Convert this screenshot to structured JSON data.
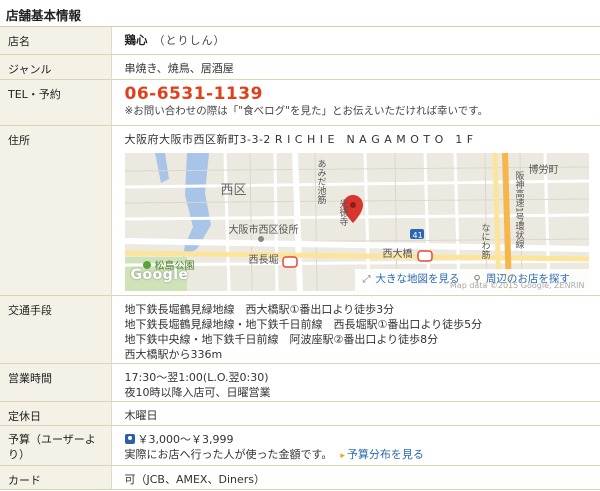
{
  "section": {
    "title": "店舗基本情報"
  },
  "rows": {
    "name": {
      "label": "店名",
      "value": "鶏心",
      "kana": "（とりしん）"
    },
    "genre": {
      "label": "ジャンル",
      "value": "串焼き、焼鳥、居酒屋"
    },
    "tel": {
      "label": "TEL・予約",
      "phone": "06-6531-1139",
      "note": "※お問い合わせの際は「\"食べログ\"を見た」とお伝えいただければ幸いです。"
    },
    "address": {
      "label": "住所",
      "value": "大阪府大阪市西区新町3-3-2 R I C H I E　N A G A M O T O　1 F",
      "map": {
        "labels": [
          "西区",
          "大阪市西区役所",
          "松島公園",
          "西長堀",
          "西大橋",
          "博労町",
          "あみだ池筋",
          "光徳寺",
          "なにわ筋",
          "阪神高速1号環状線",
          "41"
        ],
        "large_map_link": "大きな地図を見る",
        "nearby_link": "周辺のお店を探す",
        "google": "Google",
        "map_data": "Map data ©2015 Google, ZENRIN"
      }
    },
    "access": {
      "label": "交通手段",
      "lines": [
        "地下鉄長堀鶴見緑地線　西大橋駅①番出口より徒歩3分",
        "地下鉄長堀鶴見緑地線・地下鉄千日前線　西長堀駅①番出口より徒歩5分",
        "地下鉄中央線・地下鉄千日前線　阿波座駅②番出口より徒歩8分",
        "西大橋駅から336m"
      ]
    },
    "hours": {
      "label": "営業時間",
      "lines": [
        "17:30～翌1:00(L.O.翌0:30)",
        "夜10時以降入店可、日曜営業"
      ]
    },
    "holiday": {
      "label": "定休日",
      "value": "木曜日"
    },
    "budget": {
      "label": "予算（ユーザーより）",
      "value": "￥3,000～￥3,999",
      "note": "実際にお店へ行った人が使った金額です。",
      "link": "予算分布を見る"
    },
    "card": {
      "label": "カード",
      "value": "可（JCB、AMEX、Diners）"
    }
  },
  "colors": {
    "phone": "#e0401a",
    "header_bg": "#f4f1e6",
    "link": "#2a6ab3",
    "pin": "#d7352d"
  }
}
